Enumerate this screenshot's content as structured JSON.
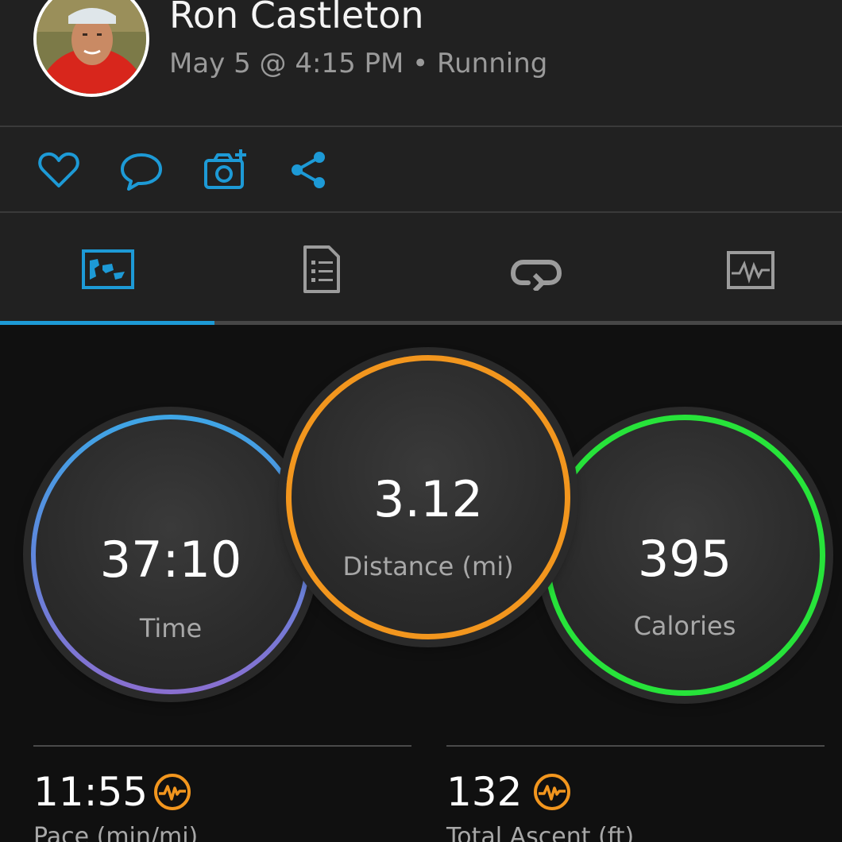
{
  "header": {
    "user_name": "Ron Castleton",
    "date_time": "May 5 @ 4:15 PM",
    "separator": "•",
    "activity_type": "Running"
  },
  "actions": [
    {
      "icon": "heart-icon",
      "name": "like"
    },
    {
      "icon": "comment-icon",
      "name": "comment"
    },
    {
      "icon": "add-photo-icon",
      "name": "add-photo"
    },
    {
      "icon": "share-icon",
      "name": "share"
    }
  ],
  "tabs": [
    {
      "icon": "map-overview-icon",
      "selected": true
    },
    {
      "icon": "details-document-icon",
      "selected": false
    },
    {
      "icon": "laps-icon",
      "selected": false
    },
    {
      "icon": "charts-icon",
      "selected": false
    }
  ],
  "stats_rings": {
    "time": {
      "value": "37:10",
      "label": "Time"
    },
    "distance": {
      "value": "3.12",
      "label": "Distance (mi)"
    },
    "calories": {
      "value": "395",
      "label": "Calories"
    }
  },
  "detail_stats": {
    "pace": {
      "value": "11:55",
      "label": "Pace (min/mi)"
    },
    "ascent": {
      "value": "132",
      "label": "Total Ascent (ft)"
    }
  },
  "colors": {
    "accent": "#1d9ad6",
    "time_ring_top": "#3ea6e6",
    "time_ring_bottom": "#8a6fd0",
    "distance_ring": "#f2961e",
    "calories_ring": "#27e33a",
    "stat_icon": "#f2961e"
  }
}
